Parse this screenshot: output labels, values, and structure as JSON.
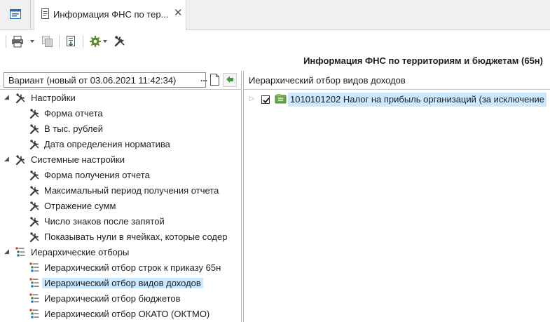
{
  "tabs": {
    "home_icon": "window-icon",
    "document_tab_title": "Информация ФНС по тер...",
    "document_tab_close": "✕"
  },
  "toolbar": {
    "icons": [
      "printer-icon",
      "copy-icon",
      "export-icon",
      "gear-icon",
      "tools-icon"
    ]
  },
  "report": {
    "title": "Информация ФНС по территориям и бюджетам (65н)"
  },
  "left_panel": {
    "variant_label": "Вариант (новый от 03.06.2021 11:42:34)",
    "variant_dots": "...",
    "tree": [
      {
        "label": "Настройки",
        "level": 0,
        "icon": "tools-icon",
        "expander": "◢"
      },
      {
        "label": "Форма отчета",
        "level": 1,
        "icon": "tools-icon"
      },
      {
        "label": "В тыс. рублей",
        "level": 1,
        "icon": "tools-icon"
      },
      {
        "label": "Дата определения норматива",
        "level": 1,
        "icon": "tools-icon"
      },
      {
        "label": "Системные настройки",
        "level": 0,
        "icon": "tools-icon",
        "expander": "◢"
      },
      {
        "label": "Форма получения отчета",
        "level": 1,
        "icon": "tools-icon"
      },
      {
        "label": "Максимальный период получения отчета",
        "level": 1,
        "icon": "tools-icon"
      },
      {
        "label": "Отражение сумм",
        "level": 1,
        "icon": "tools-icon"
      },
      {
        "label": "Число знаков после запятой",
        "level": 1,
        "icon": "tools-icon"
      },
      {
        "label": "Показывать нули в ячейках, которые содер",
        "level": 1,
        "icon": "tools-icon"
      },
      {
        "label": "Иерархические отборы",
        "level": 0,
        "icon": "hierarchy-icon",
        "expander": "◢"
      },
      {
        "label": "Иерархический отбор строк к приказу 65н",
        "level": 1,
        "icon": "hierarchy-icon"
      },
      {
        "label": "Иерархический отбор видов доходов",
        "level": 1,
        "icon": "hierarchy-icon",
        "selected": true
      },
      {
        "label": "Иерархический отбор бюджетов",
        "level": 1,
        "icon": "hierarchy-icon"
      },
      {
        "label": "Иерархический отбор ОКАТО (ОКТМО)",
        "level": 1,
        "icon": "hierarchy-icon"
      }
    ]
  },
  "right_panel": {
    "header": "Иерархический отбор видов доходов",
    "rows": [
      {
        "label": "1010101202 Налог на прибыль организаций (за исключение",
        "checked": true,
        "expander": "▷"
      }
    ]
  },
  "colors": {
    "selection": "#cce8ff",
    "tab_bar": "#f0f0f0",
    "folder_green": "#6aa84f"
  }
}
